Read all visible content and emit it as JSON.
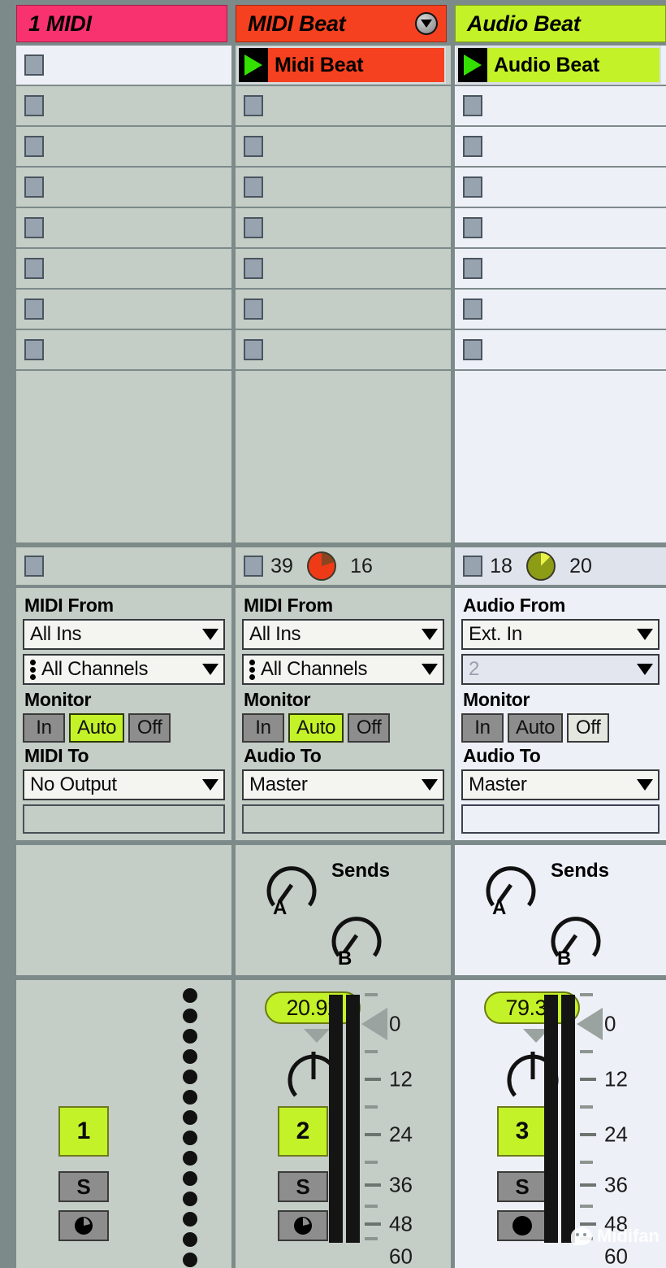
{
  "app": {
    "view": "Session View"
  },
  "tracks": [
    {
      "name": "1 MIDI",
      "color": "#f8326f",
      "type": "midi",
      "selected": false,
      "has_fold_button": false,
      "clips": [
        {
          "kind": "empty",
          "selected": true
        },
        {
          "kind": "empty",
          "selected": false
        },
        {
          "kind": "empty",
          "selected": false
        },
        {
          "kind": "empty",
          "selected": false
        },
        {
          "kind": "empty",
          "selected": false
        },
        {
          "kind": "empty",
          "selected": false
        },
        {
          "kind": "empty",
          "selected": false
        },
        {
          "kind": "empty",
          "selected": false
        }
      ],
      "perf": {
        "left": "",
        "right": "",
        "pie": "none"
      },
      "io": {
        "from_label": "MIDI From",
        "from_value": "All Ins",
        "channel_value": "All Channels",
        "channel_dim": false,
        "monitor_label": "Monitor",
        "monitor_options": [
          "In",
          "Auto",
          "Off"
        ],
        "monitor_selected": "Auto",
        "to_label": "MIDI To",
        "to_value": "No Output"
      },
      "sends": {
        "label": "",
        "knobs": []
      },
      "mixer": {
        "volume": "",
        "activator": "1",
        "solo": "S",
        "arm_icon": "record-arm-midi-icon",
        "show_volume_pill": false,
        "show_pan": false,
        "show_meter": false,
        "show_midi_dots": true,
        "midi_dot_count": 14
      }
    },
    {
      "name": "MIDI Beat",
      "color": "#f5411f",
      "type": "midi",
      "selected": false,
      "has_fold_button": true,
      "clips": [
        {
          "kind": "clip",
          "label": "Midi Beat",
          "color": "#f5411f",
          "selected": false
        },
        {
          "kind": "empty",
          "selected": false
        },
        {
          "kind": "empty",
          "selected": false
        },
        {
          "kind": "empty",
          "selected": false
        },
        {
          "kind": "empty",
          "selected": false
        },
        {
          "kind": "empty",
          "selected": false
        },
        {
          "kind": "empty",
          "selected": false
        },
        {
          "kind": "empty",
          "selected": false
        }
      ],
      "perf": {
        "left": "39",
        "right": "16",
        "pie": "red"
      },
      "io": {
        "from_label": "MIDI From",
        "from_value": "All Ins",
        "channel_value": "All Channels",
        "channel_dim": false,
        "monitor_label": "Monitor",
        "monitor_options": [
          "In",
          "Auto",
          "Off"
        ],
        "monitor_selected": "Auto",
        "to_label": "Audio To",
        "to_value": "Master"
      },
      "sends": {
        "label": "Sends",
        "knobs": [
          "A",
          "B"
        ]
      },
      "mixer": {
        "volume": "20.92",
        "activator": "2",
        "solo": "S",
        "arm_icon": "record-arm-midi-icon",
        "show_volume_pill": true,
        "show_pan": true,
        "show_meter": true,
        "show_midi_dots": false,
        "midi_dot_count": 0
      }
    },
    {
      "name": "Audio Beat",
      "color": "#c4f229",
      "type": "audio",
      "selected": true,
      "has_fold_button": false,
      "clips": [
        {
          "kind": "clip",
          "label": "Audio Beat",
          "color": "#c4f229",
          "selected": false
        },
        {
          "kind": "empty",
          "selected": false
        },
        {
          "kind": "empty",
          "selected": false
        },
        {
          "kind": "empty",
          "selected": false
        },
        {
          "kind": "empty",
          "selected": false
        },
        {
          "kind": "empty",
          "selected": false
        },
        {
          "kind": "empty",
          "selected": false
        },
        {
          "kind": "empty",
          "selected": false
        }
      ],
      "perf": {
        "left": "18",
        "right": "20",
        "pie": "olive"
      },
      "io": {
        "from_label": "Audio From",
        "from_value": "Ext. In",
        "channel_value": "2",
        "channel_dim": true,
        "monitor_label": "Monitor",
        "monitor_options": [
          "In",
          "Auto",
          "Off"
        ],
        "monitor_selected": "Off",
        "to_label": "Audio To",
        "to_value": "Master"
      },
      "sends": {
        "label": "Sends",
        "knobs": [
          "A",
          "B"
        ]
      },
      "mixer": {
        "volume": "79.38",
        "activator": "3",
        "solo": "S",
        "arm_icon": "record-arm-audio-icon",
        "show_volume_pill": true,
        "show_pan": true,
        "show_meter": true,
        "show_midi_dots": false,
        "midi_dot_count": 0
      }
    }
  ],
  "meter_scale": {
    "labels": [
      "0",
      "12",
      "24",
      "36",
      "48",
      "60"
    ]
  },
  "watermark": {
    "text": "Midifan"
  }
}
